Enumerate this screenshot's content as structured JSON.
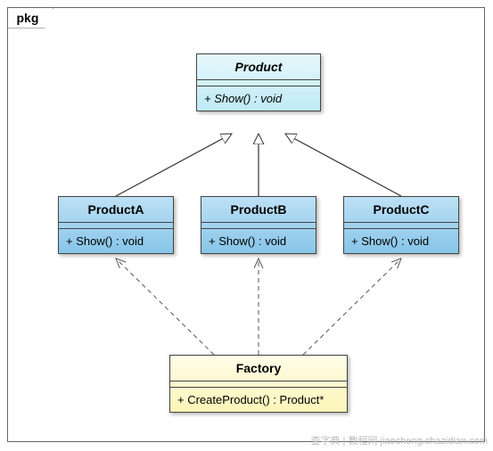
{
  "package": {
    "name": "pkg"
  },
  "classes": {
    "product": {
      "name": "Product",
      "operation": "+ Show() : void",
      "abstract": true
    },
    "productA": {
      "name": "ProductA",
      "operation": "+ Show() : void"
    },
    "productB": {
      "name": "ProductB",
      "operation": "+ Show() : void"
    },
    "productC": {
      "name": "ProductC",
      "operation": "+ Show() : void"
    },
    "factory": {
      "name": "Factory",
      "operation": "+ CreateProduct() : Product*"
    }
  },
  "relations": [
    {
      "from": "productA",
      "to": "product",
      "type": "generalization"
    },
    {
      "from": "productB",
      "to": "product",
      "type": "generalization"
    },
    {
      "from": "productC",
      "to": "product",
      "type": "generalization"
    },
    {
      "from": "factory",
      "to": "productA",
      "type": "dependency"
    },
    {
      "from": "factory",
      "to": "productB",
      "type": "dependency"
    },
    {
      "from": "factory",
      "to": "productC",
      "type": "dependency"
    }
  ],
  "watermark": "查字典 | 教程网  jiaocheng.chazidian.com"
}
